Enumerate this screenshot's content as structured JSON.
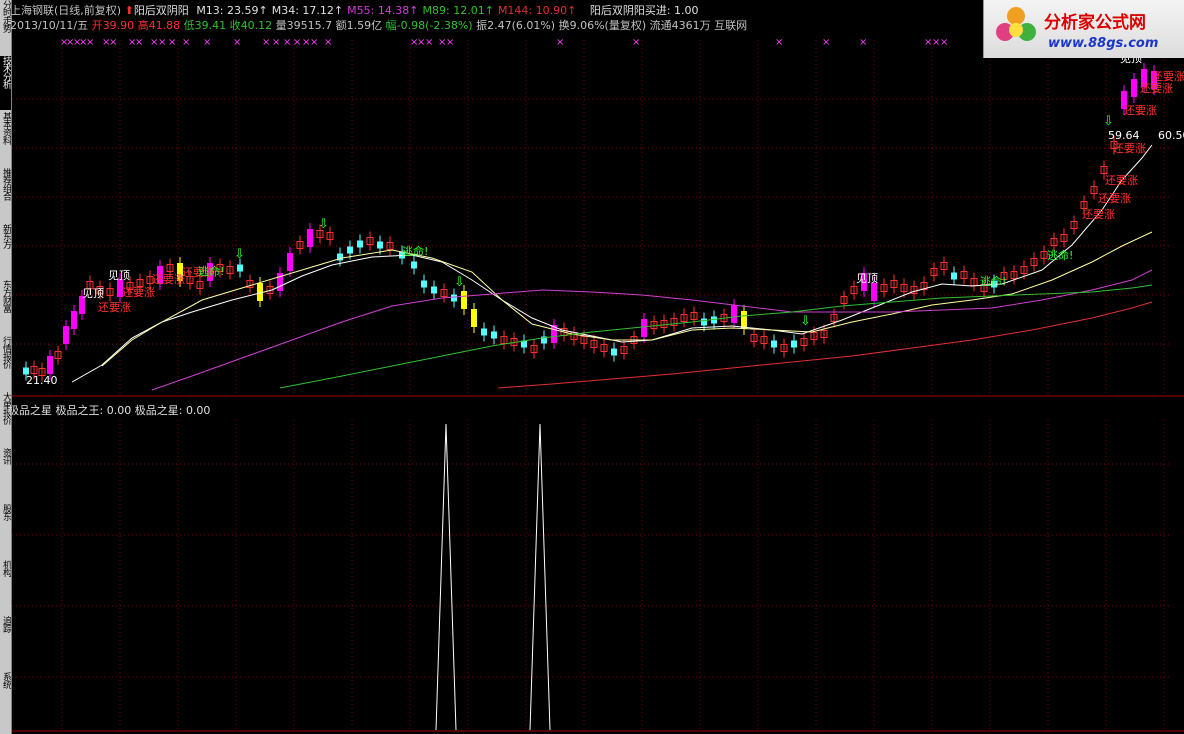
{
  "sidebar": {
    "tabs": [
      {
        "label": "分时走势",
        "active": false
      },
      {
        "label": "技术分析",
        "active": true
      },
      {
        "label": "基本资料",
        "active": false
      },
      {
        "label": "推荐组合",
        "active": false
      },
      {
        "label": "新东方",
        "active": false
      },
      {
        "label": "东方财富",
        "active": false
      },
      {
        "label": "行情报价",
        "active": false
      },
      {
        "label": "大单报价",
        "active": false
      },
      {
        "label": "资讯",
        "active": false
      },
      {
        "label": "股东",
        "active": false
      },
      {
        "label": "机构",
        "active": false
      },
      {
        "label": "追踪",
        "active": false
      },
      {
        "label": "系统",
        "active": false
      }
    ]
  },
  "header": {
    "stock_name": "上海钢联",
    "period": "(日线,前复权)",
    "indicator_name": "阳后双阴阳",
    "ma": [
      {
        "label": "M13:",
        "value": "23.59",
        "color": "#e0e0e0"
      },
      {
        "label": "M34:",
        "value": "17.12",
        "color": "#e0e0e0"
      },
      {
        "label": "M55:",
        "value": "14.38",
        "color": "#d040d0"
      },
      {
        "label": "M89:",
        "value": "12.01",
        "color": "#30c030"
      },
      {
        "label": "M144:",
        "value": "10.90",
        "color": "#e03030"
      }
    ],
    "signal_text": "阳后双阴阳买进: 1.00",
    "date": "2013/10/11/五",
    "open": "开39.90",
    "high": "高41.88",
    "low": "低39.41",
    "close": "收40.12",
    "volume": "量39515.7",
    "amount": "额1.59亿",
    "change": "幅-0.98(-2.38%)",
    "amplitude": "振2.47(6.01%)",
    "turnover": "换9.06%(量复权)",
    "float": "流通4361万",
    "industry": "互联网"
  },
  "logo": {
    "title": "分析家公式网",
    "url": "www.88gs.com"
  },
  "chart_annotations": {
    "see_top": "见顶",
    "still_rise": "还要涨",
    "escape": "逃命!",
    "low_price": "21.40",
    "high_price": "59.64",
    "high_price2": "60.50",
    "see_top_top": "见顶"
  },
  "lower_panel": {
    "title": "极品之星",
    "king_label": "极品之王:",
    "king_value": "0.00",
    "star_label": "极品之星:",
    "star_value": "0.00"
  },
  "colors": {
    "up": "#ff3030",
    "down": "#54ffff",
    "magenta": "#ff00ff",
    "yellow": "#ffff00",
    "ma13": "#ffffff",
    "ma34": "#ffffa0",
    "ma55": "#d040d0",
    "ma89": "#30c030",
    "ma144": "#e03030",
    "grid": "#800000"
  }
}
